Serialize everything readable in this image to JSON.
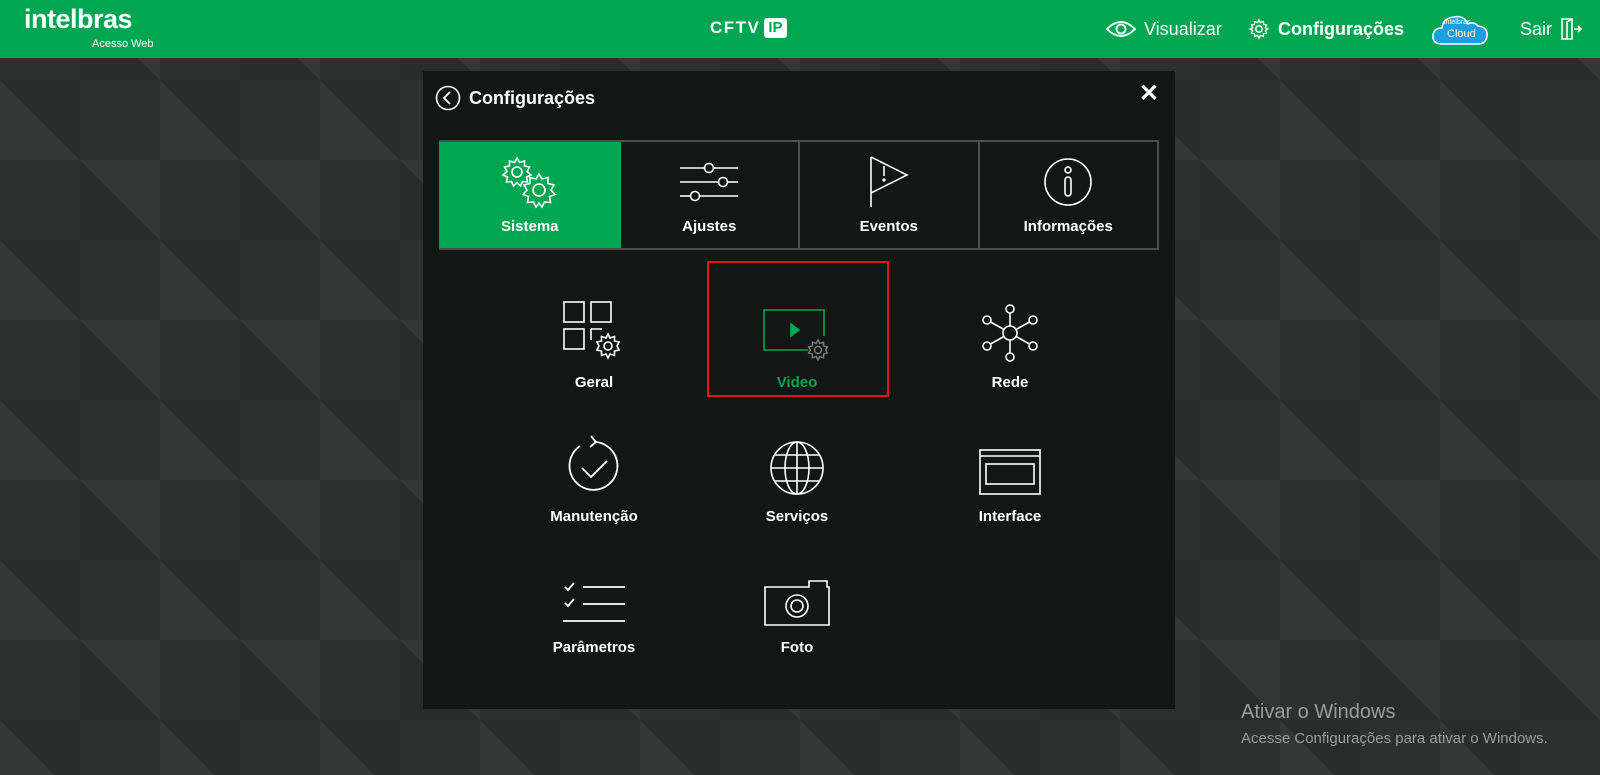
{
  "topbar": {
    "logo_text": "intelbras",
    "logo_sub": "Acesso Web",
    "product_name": "CFTV",
    "product_badge": "IP",
    "nav_visualizar": "Visualizar",
    "nav_configuracoes": "Configurações",
    "cloud_brand": "intelbras",
    "cloud_label": "Cloud",
    "nav_sair": "Sair",
    "brand_color": "#00a651"
  },
  "dialog": {
    "title": "Configurações",
    "close_glyph": "✕",
    "tabs": [
      {
        "label": "Sistema",
        "icon": "gears-icon",
        "active": true
      },
      {
        "label": "Ajustes",
        "icon": "sliders-icon",
        "active": false
      },
      {
        "label": "Eventos",
        "icon": "flag-icon",
        "active": false
      },
      {
        "label": "Informações",
        "icon": "info-icon",
        "active": false
      }
    ],
    "items": [
      {
        "label": "Geral",
        "icon": "grid-gear-icon"
      },
      {
        "label": "Video",
        "icon": "video-settings-icon",
        "selected": true
      },
      {
        "label": "Rede",
        "icon": "network-icon"
      },
      {
        "label": "Manutenção",
        "icon": "restore-check-icon"
      },
      {
        "label": "Serviços",
        "icon": "globe-icon"
      },
      {
        "label": "Interface",
        "icon": "window-icon"
      },
      {
        "label": "Parâmetros",
        "icon": "checklist-icon"
      },
      {
        "label": "Foto",
        "icon": "camera-icon"
      }
    ],
    "highlight_color": "#e0161b"
  },
  "watermark": {
    "title": "Ativar o Windows",
    "subtitle": "Acesse Configurações para ativar o Windows."
  }
}
